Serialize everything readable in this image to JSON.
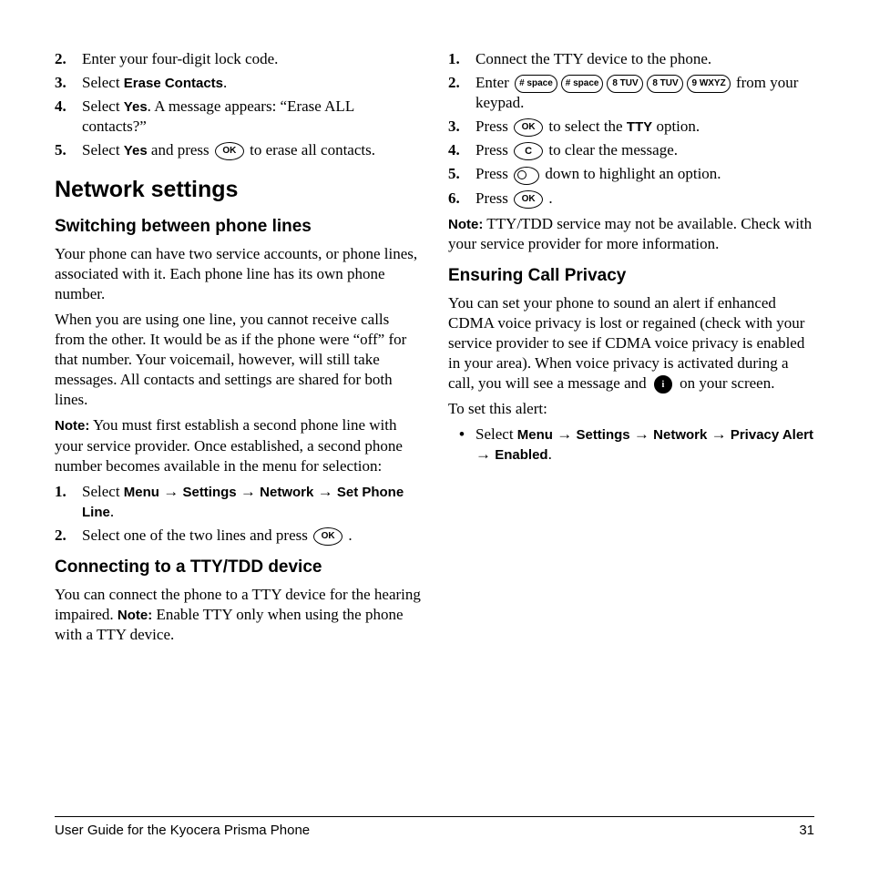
{
  "left": {
    "erase_steps": [
      {
        "n": "2.",
        "t": "Enter your four-digit lock code."
      },
      {
        "n": "3.",
        "pre": "Select ",
        "b": "Erase Contacts",
        "post": "."
      },
      {
        "n": "4.",
        "pre": "Select ",
        "b": "Yes",
        "post": ". A message appears: “Erase ALL contacts?”"
      },
      {
        "n": "5.",
        "pre": "Select ",
        "b": "Yes",
        "mid": " and press ",
        "key": "OK",
        "post": " to erase all contacts."
      }
    ],
    "h2": "Network settings",
    "h3a": "Switching between phone lines",
    "p1": "Your phone can have two service accounts, or phone lines, associated with it. Each phone line has its own phone number.",
    "p2": "When you are using one line, you cannot receive calls from the other. It would be as if the phone were “off” for that number. Your voicemail, however, will still take messages. All contacts and settings are shared for both lines.",
    "note_label": "Note:",
    "note_body": "  You must first establish a second phone line with your service provider. Once established, a second phone number becomes available in the menu for selection:",
    "net_steps": {
      "s1_n": "1.",
      "s1_pre": "Select ",
      "s1_menu": "Menu",
      "arrow": " → ",
      "s1_settings": "Settings",
      "s1_network": "Network",
      "s1_setline": "Set Phone Line",
      "s1_post": ".",
      "s2_n": "2.",
      "s2_pre": "Select one of the two lines and press ",
      "s2_key": "OK",
      "s2_post": " ."
    },
    "h3b": "Connecting to a TTY/TDD device",
    "tty_p_a": "You can connect the phone to a TTY device for the hearing impaired. ",
    "tty_note": "Note:",
    "tty_p_b": " Enable TTY only when using the phone with a TTY device."
  },
  "right": {
    "tty_steps": {
      "s1": {
        "n": "1.",
        "t": "Connect the TTY device to the phone."
      },
      "s2": {
        "n": "2.",
        "pre": "Enter ",
        "k1": "# space",
        "k2": "# space",
        "k3": "8 TUV",
        "k4": "8 TUV",
        "k5": "9 WXYZ",
        "post": " from your keypad."
      },
      "s3": {
        "n": "3.",
        "pre": "Press ",
        "key": "OK",
        "mid": " to select the ",
        "b": "TTY",
        "post": " option."
      },
      "s4": {
        "n": "4.",
        "pre": "Press ",
        "key": "C",
        "post": " to clear the message."
      },
      "s5": {
        "n": "5.",
        "pre": "Press ",
        "post": " down to highlight an option."
      },
      "s6": {
        "n": "6.",
        "pre": "Press ",
        "key": "OK",
        "post": " ."
      }
    },
    "note_label": "Note:",
    "note_body": "  TTY/TDD service may not be available. Check with your service provider for more information.",
    "h3": "Ensuring Call Privacy",
    "p_a": "You can set your phone to sound an alert if enhanced CDMA voice privacy is lost or regained (check with your service provider to see if CDMA voice privacy is enabled in your area). When voice privacy is activated during a call, you will see a message and ",
    "lock": "🔒",
    "p_b": " on your screen.",
    "p2": "To set this alert:",
    "priv": {
      "pre": "Select ",
      "menu": "Menu",
      "arrow": " → ",
      "settings": "Settings",
      "network": "Network",
      "alert": "Privacy Alert",
      "enabled": " Enabled",
      "post": "."
    }
  },
  "footer": {
    "left": "User Guide for the Kyocera Prisma Phone",
    "right": "31"
  }
}
